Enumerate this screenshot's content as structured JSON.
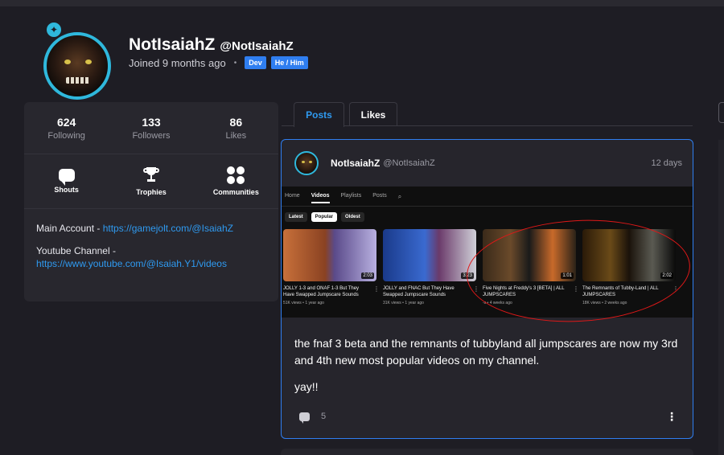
{
  "profile": {
    "display_name": "NotIsaiahZ",
    "handle": "@NotIsaiahZ",
    "joined": "Joined 9 months ago",
    "separator": "•",
    "tags": [
      "Dev",
      "He / Him"
    ]
  },
  "stats": [
    {
      "value": "624",
      "label": "Following"
    },
    {
      "value": "133",
      "label": "Followers"
    },
    {
      "value": "86",
      "label": "Likes"
    }
  ],
  "links": [
    {
      "label": "Shouts",
      "icon": "speech-bubble-icon"
    },
    {
      "label": "Trophies",
      "icon": "trophy-icon"
    },
    {
      "label": "Communities",
      "icon": "communities-icon"
    }
  ],
  "bio": {
    "line1_prefix": "Main Account - ",
    "line1_link": "https://gamejolt.com/@IsaiahZ",
    "line2_prefix": "Youtube Channel - ",
    "line2_link": "https://www.youtube.com/@Isaiah.Y1/videos"
  },
  "tabs": {
    "posts": "Posts",
    "likes": "Likes"
  },
  "post": {
    "author": "NotIsaiahZ",
    "handle": "@NotIsaiahZ",
    "time": "12 days",
    "text1": "the fnaf 3 beta and the remnants of tubbyland all jumpscares are now my 3rd and 4th new most popular videos on my channel.",
    "text2": "yay!!",
    "comments": "5",
    "menu": "⋮"
  },
  "embed": {
    "nav": [
      "Home",
      "Videos",
      "Playlists",
      "Posts"
    ],
    "chips": [
      "Latest",
      "Popular",
      "Oldest"
    ],
    "videos": [
      {
        "title": "JOLLY 1-3 and ONAF 1-3 But They Have Swapped Jumpscare Sounds",
        "meta": "51K views • 1 year ago",
        "duration": "2:03"
      },
      {
        "title": "JOLLY and FNAC But They Have Swapped Jumpscare Sounds",
        "meta": "31K views • 1 year ago",
        "duration": "3:23"
      },
      {
        "title": "Five Nights at Freddy's 3 [BETA] | ALL JUMPSCARES",
        "meta": "-s • 4 weeks ago",
        "duration": "1:01"
      },
      {
        "title": "The Remnants of Tubby-Land | ALL JUMPSCARES",
        "meta": "18K views • 2 weeks ago",
        "duration": "2:02"
      }
    ],
    "annotation_color": "#e01818"
  },
  "colors": {
    "background": "#1e1d24",
    "card": "#28272e",
    "accent": "#2f9af0",
    "tag": "#2f7ef0",
    "avatar_ring": "#2fb8dc"
  }
}
